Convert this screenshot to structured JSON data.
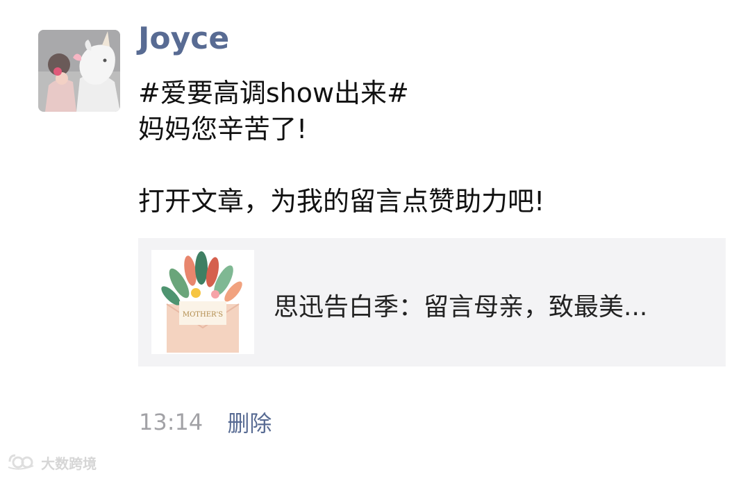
{
  "post": {
    "author_name": "Joyce",
    "lines": [
      "#爱要高调show出来#",
      "妈妈您辛苦了!",
      "",
      "打开文章，为我的留言点赞助力吧!"
    ],
    "avatar_icon": "unicorn-mask-avatar"
  },
  "link_card": {
    "title": "思迅告白季：留言母亲，致最美...",
    "thumbnail_icon": "mothers-day-flower-envelope",
    "thumbnail_text": "MOTHER'S"
  },
  "footer": {
    "time": "13:14",
    "delete_label": "删除"
  },
  "watermark": {
    "text": "大数跨境"
  },
  "colors": {
    "name": "#586b93",
    "link": "#586b93",
    "time": "#a2a2a6",
    "card_bg": "#f3f3f5",
    "text": "#111111"
  }
}
